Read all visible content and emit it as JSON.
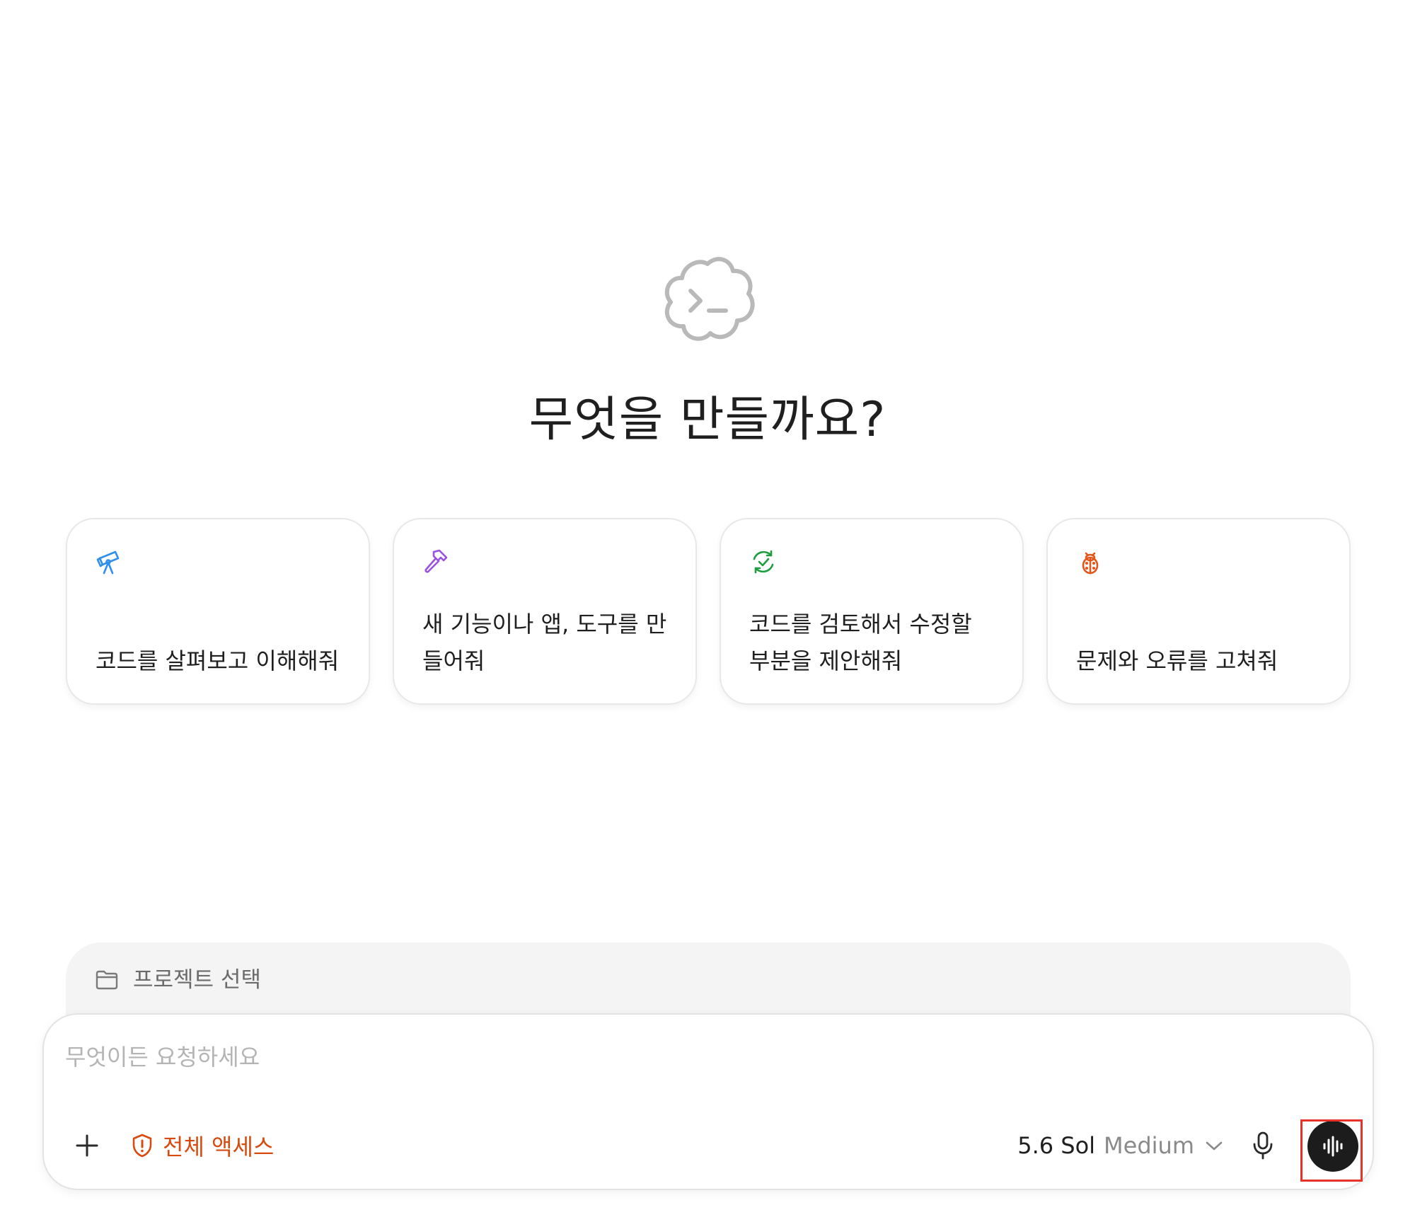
{
  "headline": "무엇을 만들까요?",
  "cards": [
    {
      "text": "코드를 살펴보고 이해해줘",
      "icon": "telescope-icon",
      "color": "#2f8fec"
    },
    {
      "text": "새 기능이나 앱, 도구를 만들어줘",
      "icon": "hammer-icon",
      "color": "#9b51e0"
    },
    {
      "text": "코드를 검토해서 수정할 부분을 제안해줘",
      "icon": "review-check-icon",
      "color": "#1e9e3e"
    },
    {
      "text": "문제와 오류를 고쳐줘",
      "icon": "bug-icon",
      "color": "#e2561a"
    }
  ],
  "project": {
    "label": "프로젝트 선택",
    "icon": "folder-icon"
  },
  "composer": {
    "placeholder": "무엇이든 요청하세요",
    "plus_icon": "plus-icon",
    "access_label": "전체 액세스",
    "access_icon": "shield-alert-icon",
    "access_color": "#d94a0e",
    "model_name": "5.6 Sol",
    "model_effort": "Medium",
    "chevron_icon": "chevron-down-icon",
    "mic_icon": "microphone-icon",
    "voice_icon": "waveform-icon"
  },
  "highlight_color": "#e5332a"
}
